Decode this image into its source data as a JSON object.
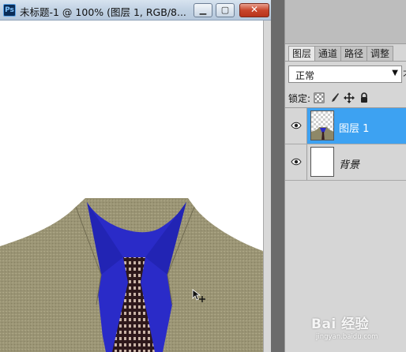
{
  "document": {
    "title": "未标题-1 @ 100% (图层 1, RGB/8...",
    "app_icon_text": "Ps",
    "controls": {
      "minimize": "▁",
      "maximize": "▢",
      "close": "✕"
    }
  },
  "layers_panel": {
    "tabs": [
      {
        "label": "图层",
        "active": true
      },
      {
        "label": "通道",
        "active": false
      },
      {
        "label": "路径",
        "active": false
      },
      {
        "label": "调整",
        "active": false
      }
    ],
    "blend_mode": "正常",
    "opacity_label_truncated": "不",
    "lock_label": "锁定:",
    "lock_icons": [
      "lock-transparent-pixels-icon",
      "lock-image-pixels-icon",
      "lock-position-icon",
      "lock-all-icon"
    ],
    "layers": [
      {
        "name": "图层 1",
        "visible": true,
        "selected": true
      },
      {
        "name": "背景",
        "visible": true,
        "selected": false
      }
    ]
  },
  "watermark": {
    "main": "Bai 经验",
    "sub": "jingyan.baidu.com"
  },
  "colors": {
    "selection": "#3da2f2",
    "jacket": "#9a9474",
    "shirt": "#2a2bc8",
    "tie": "#3a1f22"
  }
}
